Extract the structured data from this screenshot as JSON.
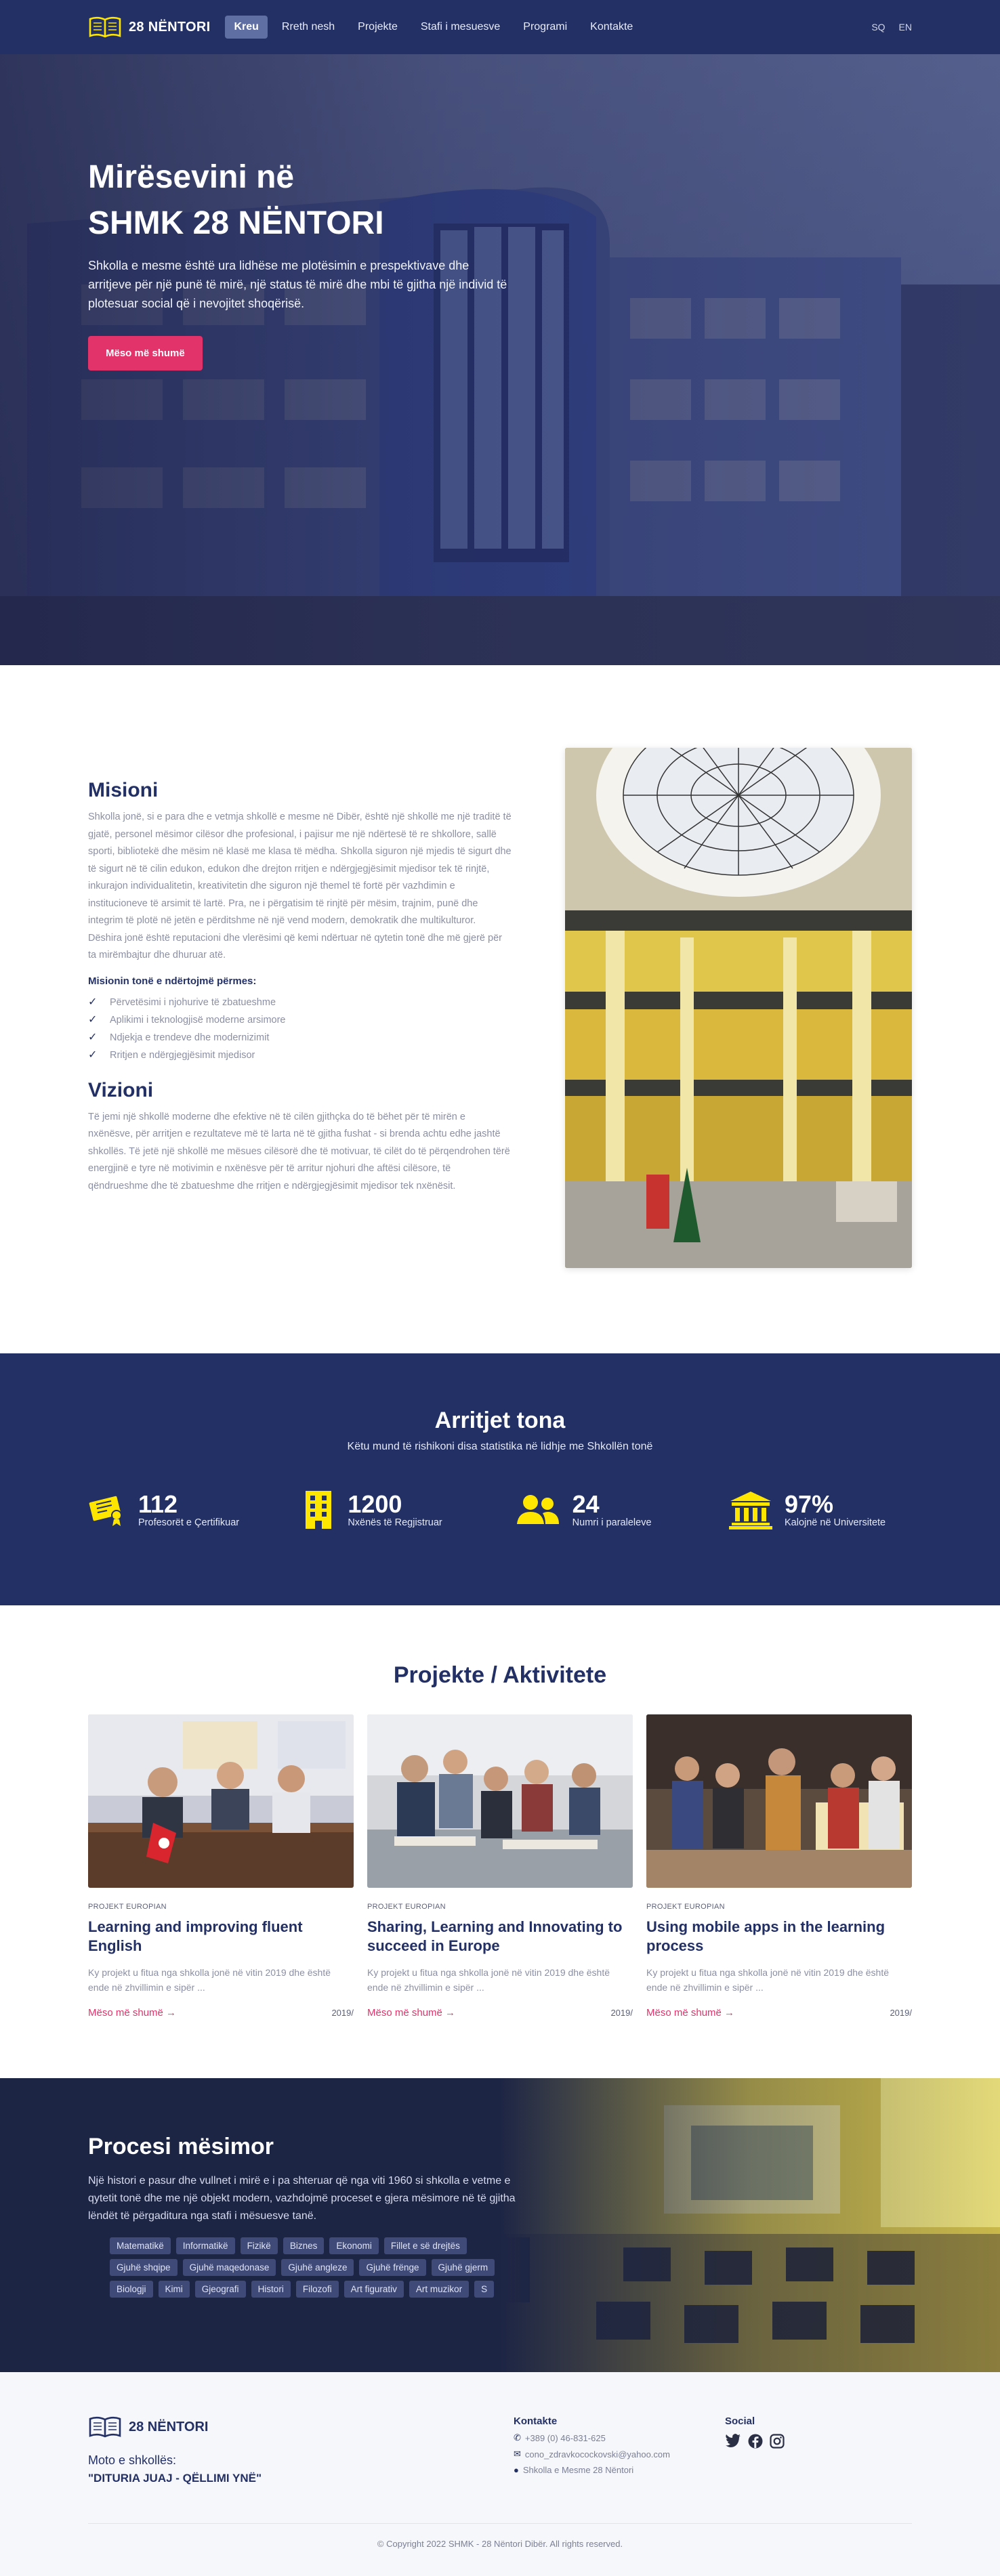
{
  "brand": {
    "name": "28 NËNTORI"
  },
  "nav": {
    "items": [
      {
        "label": "Kreu"
      },
      {
        "label": "Rreth nesh"
      },
      {
        "label": "Projekte"
      },
      {
        "label": "Stafi i mesuesve"
      },
      {
        "label": "Programi"
      },
      {
        "label": "Kontakte"
      }
    ],
    "langs": [
      "SQ",
      "EN"
    ]
  },
  "hero": {
    "title_line1": "Mirësevini në",
    "title_line2": "SHMK 28 NËNTORI",
    "text": "Shkolla e mesme është ura lidhëse me plotësimin e prespektivave dhe arritjeve për një punë të mirë, një status të mirë dhe mbi të gjitha një individ të plotesuar social që i nevojitet shoqërisë.",
    "button": "Mëso më shumë"
  },
  "mission": {
    "title": "Misioni",
    "text": "Shkolla jonë, si e para dhe e vetmja shkollë e mesme në Dibër, është një shkollë me një traditë të gjatë, personel mësimor cilësor dhe profesional, i pajisur me një ndërtesë të re shkollore, sallë sporti, bibliotekë dhe mësim në klasë me klasa të mëdha. Shkolla siguron një mjedis të sigurt dhe të sigurt në të cilin edukon, edukon dhe drejton rritjen e ndërgjegjësimit mjedisor tek të rinjtë, inkurajon individualitetin, kreativitetin dhe siguron një themel të fortë për vazhdimin e institucioneve të arsimit të lartë. Pra, ne i përgatisim të rinjtë për mësim, trajnim, punë dhe integrim të plotë në jetën e përditshme në një vend modern, demokratik dhe multikulturor. Dëshira jonë është reputacioni dhe vlerësimi që kemi ndërtuar në qytetin tonë dhe më gjerë për ta mirëmbajtur dhe dhuruar atë.",
    "list_title": "Misionin tonë e ndërtojmë përmes:",
    "list": [
      "Përvetësimi i njohurive të zbatueshme",
      "Aplikimi i teknologjisë moderne arsimore",
      "Ndjekja e trendeve dhe modernizimit",
      "Rritjen e ndërgjegjësimit mjedisor"
    ]
  },
  "vision": {
    "title": "Vizioni",
    "text": "Të jemi një shkollë moderne dhe efektive në të cilën gjithçka do të bëhet për të mirën e nxënësve, për arritjen e rezultateve më të larta në të gjitha fushat - si brenda achtu edhe jashtë shkollës. Të jetë një shkollë me mësues cilësorë dhe të motivuar, të cilët do të përqendrohen tërë energjinë e tyre në motivimin e nxënësve për të arritur njohuri dhe aftësi cilësore, të qëndrueshme dhe të zbatueshme dhe rritjen e ndërgjegjësimit mjedisor tek nxënësit."
  },
  "stats": {
    "title": "Arritjet tona",
    "subtitle": "Këtu mund të rishikoni disa statistika në lidhje me Shkollën tonë",
    "items": [
      {
        "value": "112",
        "label": "Profesorët e Çertifikuar",
        "icon": "certificate-icon"
      },
      {
        "value": "1200",
        "label": "Nxënës të Regjistruar",
        "icon": "building-icon"
      },
      {
        "value": "24",
        "label": "Numri i paraleleve",
        "icon": "users-icon"
      },
      {
        "value": "97%",
        "label": "Kalojnë në Universitete",
        "icon": "university-icon"
      }
    ],
    "accent": "#ffe600"
  },
  "projects": {
    "title": "Projekte / Aktivitete",
    "cards": [
      {
        "tag": "PROJEKT EUROPIAN",
        "title": "Learning and improving fluent English",
        "desc": "Ky projekt u fitua nga shkolla jonë në vitin 2019 dhe është ende në zhvillimin e sipër ...",
        "more": "Mëso më shumë",
        "year": "2019/"
      },
      {
        "tag": "PROJEKT EUROPIAN",
        "title": "Sharing, Learning and Innovating to succeed in Europe",
        "desc": "Ky projekt u fitua nga shkolla jonë në vitin 2019 dhe është ende në zhvillimin e sipër ...",
        "more": "Mëso më shumë",
        "year": "2019/"
      },
      {
        "tag": "PROJEKT EUROPIAN",
        "title": "Using mobile apps in the learning process",
        "desc": "Ky projekt u fitua nga shkolla jonë në vitin 2019 dhe është ende në zhvillimin e sipër ...",
        "more": "Mëso më shumë",
        "year": "2019/"
      }
    ]
  },
  "process": {
    "title": "Procesi mësimor",
    "text": "Një histori e pasur dhe vullnet i mirë e i pa shteruar që nga viti 1960 si shkolla e vetme e qytetit tonë dhe me një objekt modern, vazhdojmë proceset e gjera mësimore në të gjitha lëndët të përgaditura nga stafi i mësuesve tanë.",
    "subjects_row1": [
      "Matematikë",
      "Informatikë",
      "Fizikë",
      "Biznes",
      "Ekonomi",
      "Fillet e së drejtës"
    ],
    "subjects_row2": [
      "Gjuhë shqipe",
      "Gjuhë maqedonase",
      "Gjuhë angleze",
      "Gjuhë frënge",
      "Gjuhë gjerm"
    ],
    "subjects_row3": [
      "Biologji",
      "Kimi",
      "Gjeografi",
      "Histori",
      "Filozofi",
      "Art figurativ",
      "Art muzikor",
      "S"
    ]
  },
  "footer": {
    "brand": "28 NËNTORI",
    "moto_label": "Moto e shkollës:",
    "moto": "\"DITURIA JUAJ - QËLLIMI YNË\"",
    "contact_title": "Kontakte",
    "phone": "+389 (0) 46-831-625",
    "email": "cono_zdravkocockovski@yahoo.com",
    "address": "Shkolla e Mesme 28 Nëntori",
    "social_title": "Social",
    "copyright": "© Copyright 2022 SHMK - 28 Nëntori Dibër. All rights reserved."
  }
}
